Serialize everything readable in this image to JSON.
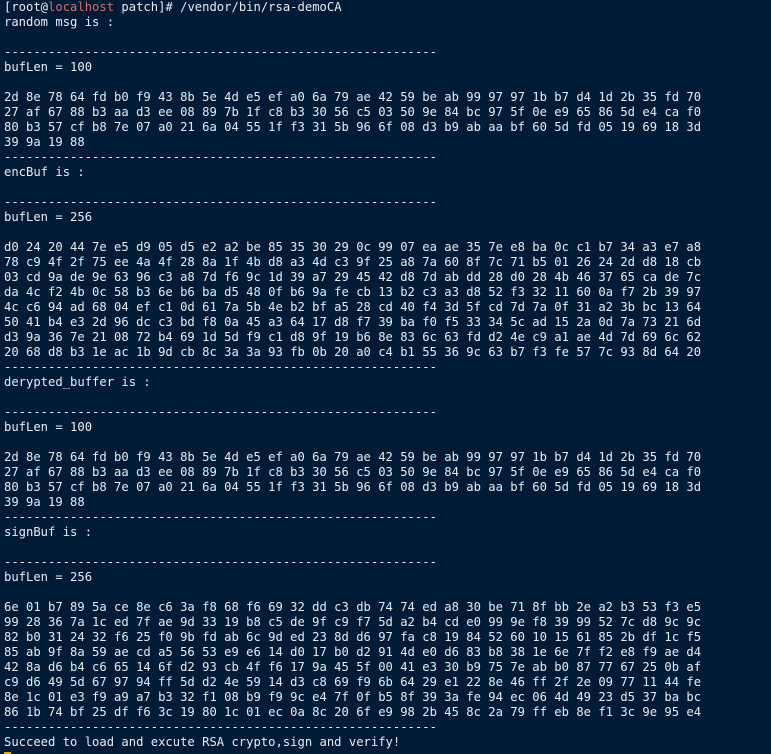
{
  "prompt": {
    "open": "[root@",
    "host": "localhost",
    "rest": " patch]# /vendor/bin/rsa-demoCA"
  },
  "separator": "-----------------------------------------------------------",
  "sections": [
    {
      "title": "random msg is :",
      "buflen": "bufLen = 100",
      "lines": [
        "2d 8e 78 64 fd b0 f9 43 8b 5e 4d e5 ef a0 6a 79 ae 42 59 be ab 99 97 97 1b b7 d4 1d 2b 35 fd 70",
        "27 af 67 88 b3 aa d3 ee 08 89 7b 1f c8 b3 30 56 c5 03 50 9e 84 bc 97 5f 0e e9 65 86 5d e4 ca f0",
        "80 b3 57 cf b8 7e 07 a0 21 6a 04 55 1f f3 31 5b 96 6f 08 d3 b9 ab aa bf 60 5d fd 05 19 69 18 3d",
        "39 9a 19 88"
      ]
    },
    {
      "title": "encBuf is :",
      "buflen": "bufLen = 256",
      "lines": [
        "d0 24 20 44 7e e5 d9 05 d5 e2 a2 be 85 35 30 29 0c 99 07 ea ae 35 7e e8 ba 0c c1 b7 34 a3 e7 a8",
        "78 c9 4f 2f 75 ee 4a 4f 28 8a 1f 4b d8 a3 4d c3 9f 25 a8 7a 60 8f 7c 71 b5 01 26 24 2d d8 18 cb",
        "03 cd 9a de 9e 63 96 c3 a8 7d f6 9c 1d 39 a7 29 45 42 d8 7d ab dd 28 d0 28 4b 46 37 65 ca de 7c",
        "da 4c f2 4b 0c 58 b3 6e b6 ba d5 48 0f b6 9a fe cb 13 b2 c3 a3 d8 52 f3 32 11 60 0a f7 2b 39 97",
        "4c c6 94 ad 68 04 ef c1 0d 61 7a 5b 4e b2 bf a5 28 cd 40 f4 3d 5f cd 7d 7a 0f 31 a2 3b bc 13 64",
        "50 41 b4 e3 2d 96 dc c3 bd f8 0a 45 a3 64 17 d8 f7 39 ba f0 f5 33 34 5c ad 15 2a 0d 7a 73 21 6d",
        "d3 9a 36 7e 21 08 72 b4 69 1d 5d f9 c1 d8 9f 19 b6 8e 83 6c 63 fd d2 4e c9 a1 ae 4d 7d 69 6c 62",
        "20 68 d8 b3 1e ac 1b 9d cb 8c 3a 3a 93 fb 0b 20 a0 c4 b1 55 36 9c 63 b7 f3 fe 57 7c 93 8d 64 20"
      ]
    },
    {
      "title": "derypted_buffer is :",
      "buflen": "bufLen = 100",
      "lines": [
        "2d 8e 78 64 fd b0 f9 43 8b 5e 4d e5 ef a0 6a 79 ae 42 59 be ab 99 97 97 1b b7 d4 1d 2b 35 fd 70",
        "27 af 67 88 b3 aa d3 ee 08 89 7b 1f c8 b3 30 56 c5 03 50 9e 84 bc 97 5f 0e e9 65 86 5d e4 ca f0",
        "80 b3 57 cf b8 7e 07 a0 21 6a 04 55 1f f3 31 5b 96 6f 08 d3 b9 ab aa bf 60 5d fd 05 19 69 18 3d",
        "39 9a 19 88"
      ]
    },
    {
      "title": "signBuf is :",
      "buflen": "bufLen = 256",
      "lines": [
        "6e 01 b7 89 5a ce 8e c6 3a f8 68 f6 69 32 dd c3 db 74 74 ed a8 30 be 71 8f bb 2e a2 b3 53 f3 e5",
        "99 28 36 7a 1c ed 7f ae 9d 33 19 b8 c5 de 9f c9 f7 5d a2 b4 cd e0 99 9e f8 39 99 52 7c d8 9c 9c",
        "82 b0 31 24 32 f6 25 f0 9b fd ab 6c 9d ed 23 8d d6 97 fa c8 19 84 52 60 10 15 61 85 2b df 1c f5",
        "85 ab 9f 8a 59 ae cd a5 56 53 e9 e6 14 d0 17 b0 d2 91 4d e0 d6 83 b8 38 1e 6e 7f f2 e8 f9 ae d4",
        "42 8a d6 b4 c6 65 14 6f d2 93 cb 4f f6 17 9a 45 5f 00 41 e3 30 b9 75 7e ab b0 87 77 67 25 0b af",
        "c9 d6 49 5d 67 97 94 ff 5d d2 4e 59 14 d3 c8 69 f9 6b 64 29 e1 22 8e 46 ff 2f 2e 09 77 11 44 fe",
        "8e 1c 01 e3 f9 a9 a7 b3 32 f1 08 b9 f9 9c e4 7f 0f b5 8f 39 3a fe 94 ec 06 4d 49 23 d5 37 ba bc",
        "86 1b 74 bf 25 df f6 3c 19 80 1c 01 ec 0a 8c 20 6f e9 98 2b 45 8c 2a 79 ff eb 8e f1 3c 9e 95 e4"
      ]
    }
  ],
  "final_message": "Succeed to load and excute RSA crypto,sign and verify!"
}
